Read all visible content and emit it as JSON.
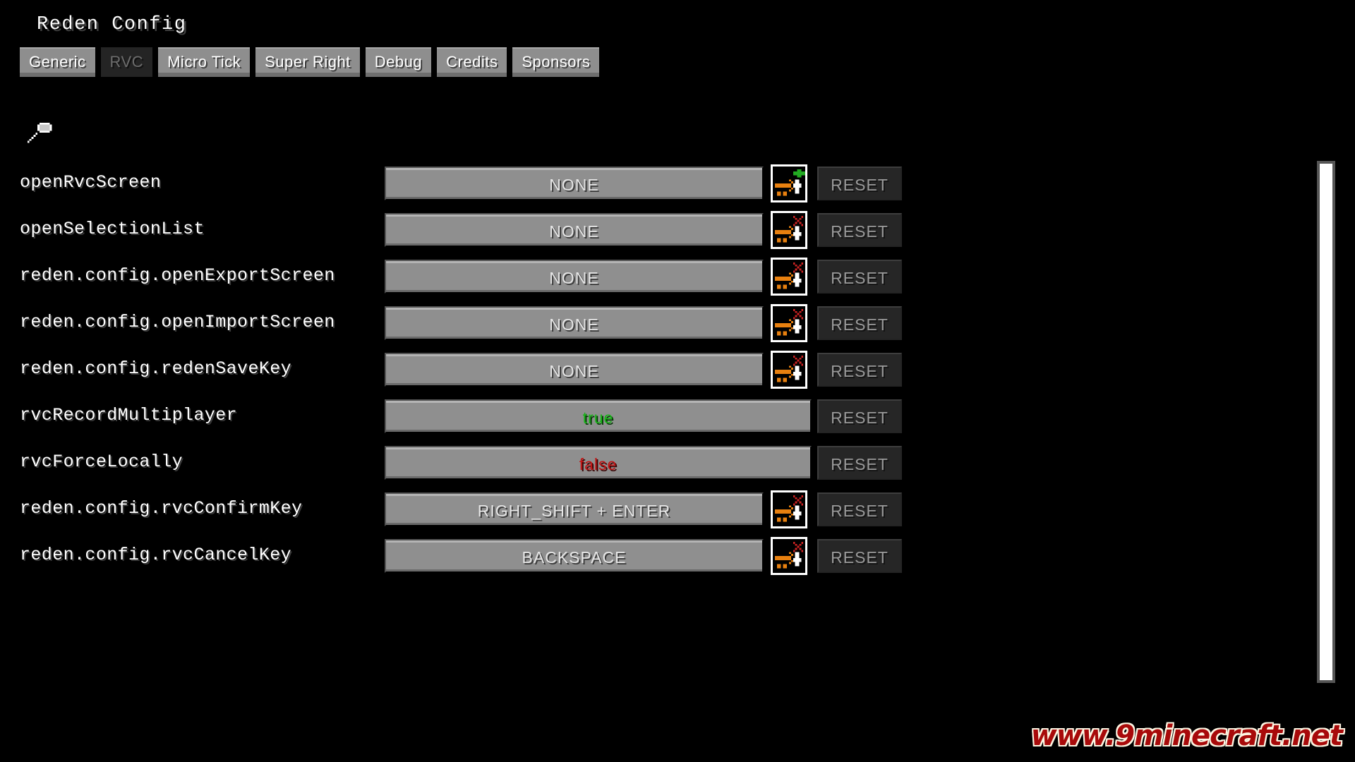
{
  "window": {
    "title": "Reden Config",
    "background_color": "#000000"
  },
  "tabs": [
    {
      "label": "Generic",
      "selected": false
    },
    {
      "label": "RVC",
      "selected": true
    },
    {
      "label": "Micro Tick",
      "selected": false
    },
    {
      "label": "Super Right",
      "selected": false
    },
    {
      "label": "Debug",
      "selected": false
    },
    {
      "label": "Credits",
      "selected": false
    },
    {
      "label": "Sponsors",
      "selected": false
    }
  ],
  "search": {
    "icon": "magnifier-icon",
    "value": "",
    "placeholder": ""
  },
  "entries": [
    {
      "label": "openRvcScreen",
      "value": "NONE",
      "value_type": "keybind",
      "conflict_icon": "keybind-no-conflict-icon",
      "conflict_state": "none",
      "reset_label": "RESET",
      "reset_enabled": false
    },
    {
      "label": "openSelectionList",
      "value": "NONE",
      "value_type": "keybind",
      "conflict_icon": "keybind-conflict-icon",
      "conflict_state": "conflict",
      "reset_label": "RESET",
      "reset_enabled": false
    },
    {
      "label": "reden.config.openExportScreen",
      "value": "NONE",
      "value_type": "keybind",
      "conflict_icon": "keybind-conflict-icon",
      "conflict_state": "conflict",
      "reset_label": "RESET",
      "reset_enabled": false
    },
    {
      "label": "reden.config.openImportScreen",
      "value": "NONE",
      "value_type": "keybind",
      "conflict_icon": "keybind-conflict-icon",
      "conflict_state": "conflict",
      "reset_label": "RESET",
      "reset_enabled": false
    },
    {
      "label": "reden.config.redenSaveKey",
      "value": "NONE",
      "value_type": "keybind",
      "conflict_icon": "keybind-conflict-icon",
      "conflict_state": "conflict",
      "reset_label": "RESET",
      "reset_enabled": false
    },
    {
      "label": "rvcRecordMultiplayer",
      "value": "true",
      "value_type": "boolean-true",
      "conflict_icon": null,
      "conflict_state": null,
      "reset_label": "RESET",
      "reset_enabled": false
    },
    {
      "label": "rvcForceLocally",
      "value": "false",
      "value_type": "boolean-false",
      "conflict_icon": null,
      "conflict_state": null,
      "reset_label": "RESET",
      "reset_enabled": false
    },
    {
      "label": "reden.config.rvcConfirmKey",
      "value": "RIGHT_SHIFT + ENTER",
      "value_type": "keybind",
      "conflict_icon": "keybind-conflict-icon",
      "conflict_state": "conflict",
      "reset_label": "RESET",
      "reset_enabled": false
    },
    {
      "label": "reden.config.rvcCancelKey",
      "value": "BACKSPACE",
      "value_type": "keybind",
      "conflict_icon": "keybind-conflict-icon",
      "conflict_state": "conflict",
      "reset_label": "RESET",
      "reset_enabled": false
    }
  ],
  "scrollbar": {
    "orientation": "vertical",
    "thumb_position": "full"
  },
  "watermark": {
    "text": "www.9minecraft.net",
    "color": "#a80a0a",
    "outline_color": "#fdf6e3"
  },
  "colors": {
    "true_green": "#17b417",
    "false_red": "#c21414",
    "conflict_red": "#cc2222",
    "ok_green": "#22aa22",
    "arrow_orange": "#e8800f",
    "button_grey": "#8f8f8f",
    "reset_dark": "#262626"
  }
}
